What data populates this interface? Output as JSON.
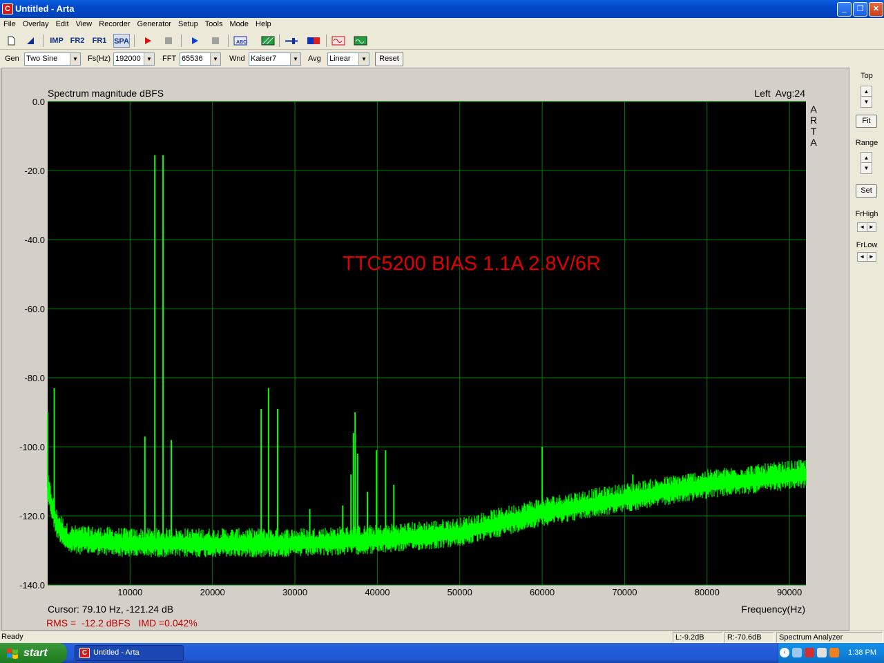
{
  "window": {
    "title": "Untitled - Arta",
    "app_icon_letter": "C"
  },
  "menu": [
    "File",
    "Overlay",
    "Edit",
    "View",
    "Recorder",
    "Generator",
    "Setup",
    "Tools",
    "Mode",
    "Help"
  ],
  "toolbar": {
    "imp_label": "IMP",
    "fr2_label": "FR2",
    "fr1_label": "FR1",
    "spa_label": "SPA"
  },
  "settings": {
    "gen_label": "Gen",
    "gen_value": "Two Sine",
    "fs_label": "Fs(Hz)",
    "fs_value": "192000",
    "fft_label": "FFT",
    "fft_value": "65536",
    "wnd_label": "Wnd",
    "wnd_value": "Kaiser7",
    "avg_label": "Avg",
    "avg_value": "Linear",
    "reset_label": "Reset"
  },
  "right_panel": {
    "top_label": "Top",
    "fit_label": "Fit",
    "range_label": "Range",
    "set_label": "Set",
    "frhigh_label": "FrHigh",
    "frlow_label": "FrLow"
  },
  "chart_data": {
    "type": "line",
    "title": "Spectrum magnitude dBFS",
    "channel_info": "Left  Avg:24",
    "brand_vertical": "ARTA",
    "annotation": "TTC5200 BIAS 1.1A 2.8V/6R",
    "xlabel": "Frequency(Hz)",
    "xlim": [
      0,
      92000
    ],
    "ylim": [
      -140,
      0
    ],
    "xticks": [
      10000,
      20000,
      30000,
      40000,
      50000,
      60000,
      70000,
      80000,
      90000
    ],
    "xtick_labels": [
      "10000",
      "20000",
      "30000",
      "40000",
      "50000",
      "60000",
      "70000",
      "80000",
      "90000"
    ],
    "yticks": [
      0,
      -20,
      -40,
      -60,
      -80,
      -100,
      -120,
      -140
    ],
    "ytick_labels": [
      "0.0",
      "-20.0",
      "-40.0",
      "-60.0",
      "-80.0",
      "-100.0",
      "-120.0",
      "-140.0"
    ],
    "grid": true,
    "colors": {
      "background": "#000000",
      "grid": "#008000",
      "trace": "#00ff00",
      "annotation": "#e00000",
      "info": "#c00000"
    },
    "noise_floor": {
      "x": [
        0,
        1000,
        2500,
        10000,
        30000,
        40000,
        50000,
        60000,
        70000,
        80000,
        92000
      ],
      "y": [
        -112,
        -122,
        -127,
        -128,
        -128,
        -127,
        -125,
        -119,
        -115,
        -111,
        -108
      ]
    },
    "peaks": [
      {
        "x": 0,
        "y": -90
      },
      {
        "x": 800,
        "y": -83
      },
      {
        "x": 11800,
        "y": -97
      },
      {
        "x": 13000,
        "y": -15.5
      },
      {
        "x": 14000,
        "y": -15.5
      },
      {
        "x": 15000,
        "y": -98
      },
      {
        "x": 25900,
        "y": -89
      },
      {
        "x": 26800,
        "y": -83
      },
      {
        "x": 27900,
        "y": -89
      },
      {
        "x": 31800,
        "y": -118
      },
      {
        "x": 35800,
        "y": -117
      },
      {
        "x": 36800,
        "y": -108
      },
      {
        "x": 37100,
        "y": -96
      },
      {
        "x": 37300,
        "y": -90
      },
      {
        "x": 37600,
        "y": -102
      },
      {
        "x": 38800,
        "y": -113
      },
      {
        "x": 39900,
        "y": -101
      },
      {
        "x": 41000,
        "y": -101
      },
      {
        "x": 42000,
        "y": -111
      },
      {
        "x": 60000,
        "y": -100
      },
      {
        "x": 71000,
        "y": -108
      }
    ]
  },
  "readouts": {
    "cursor": "Cursor: 79.10 Hz, -121.24 dB",
    "rms_imd": "RMS =  -12.2 dBFS   IMD =0.042%"
  },
  "status": {
    "ready": "Ready",
    "left_level": "L:-9.2dB",
    "right_level": "R:-70.6dB",
    "mode": "Spectrum Analyzer"
  },
  "taskbar": {
    "start_label": "start",
    "task_label": "Untitled - Arta",
    "clock": "1:38 PM"
  }
}
